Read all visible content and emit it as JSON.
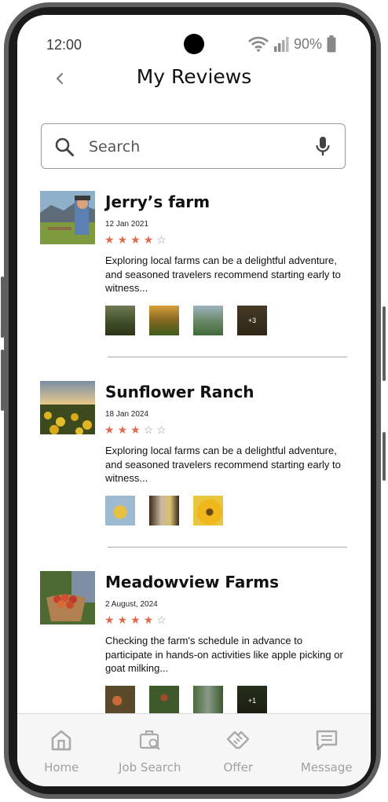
{
  "status_bar": {
    "time": "12:00",
    "battery": "90%"
  },
  "header": {
    "title": "My Reviews"
  },
  "search": {
    "placeholder": "Search"
  },
  "reviews": [
    {
      "name": "Jerry’s farm",
      "date": "12 Jan 2021",
      "rating": 4,
      "text": "Exploring local farms can be a delightful adventure, and seasoned travelers recommend starting early to witness...",
      "photos_shown": 4,
      "more_label": "+3"
    },
    {
      "name": "Sunflower Ranch",
      "date": "18 Jan 2024",
      "rating": 3,
      "text": "Exploring local farms can be a delightful adventure, and seasoned travelers recommend starting early to witness...",
      "photos_shown": 3,
      "more_label": ""
    },
    {
      "name": "Meadowview Farms",
      "date": "2 August, 2024",
      "rating": 4,
      "text": "Checking the farm's schedule in advance to participate in hands-on activities like apple picking or goat milking...",
      "photos_shown": 4,
      "more_label": "+1"
    }
  ],
  "bottom_nav": {
    "items": [
      {
        "label": "Home",
        "icon": "home-icon"
      },
      {
        "label": "Job Search",
        "icon": "job-search-icon"
      },
      {
        "label": "Offer",
        "icon": "handshake-icon"
      },
      {
        "label": "Message",
        "icon": "message-icon"
      }
    ]
  },
  "colors": {
    "star": "#e06b4e",
    "nav_text": "#a0a0a0"
  }
}
